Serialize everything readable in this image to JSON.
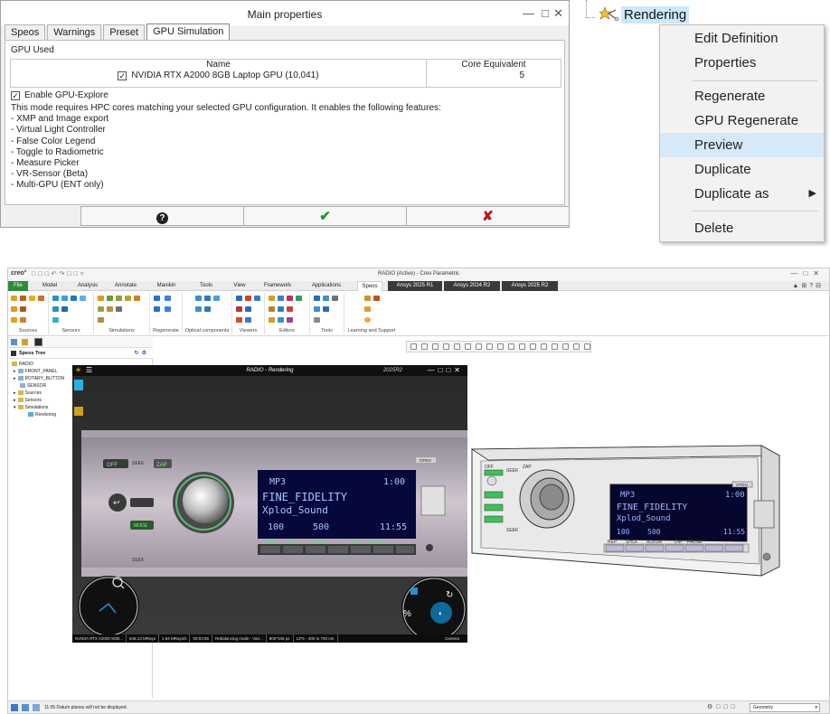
{
  "dialog": {
    "title": "Main properties",
    "tabs": [
      "Speos",
      "Warnings",
      "Preset",
      "GPU Simulation"
    ],
    "active_tab": "GPU Simulation",
    "gpu_used_label": "GPU Used",
    "table": {
      "col_name": "Name",
      "col_core": "Core Equivalent",
      "row_name": "NVIDIA RTX A2000 8GB Laptop GPU (10,041)",
      "row_core": "5",
      "row_checked": true
    },
    "enable_label": "Enable GPU-Explore",
    "enable_checked": true,
    "description": "This mode requires HPC cores matching your selected GPU configuration. It enables the following features:",
    "features": [
      "- XMP and Image export",
      "- Virtual Light Controller",
      "- False Color Legend",
      "- Toggle to Radiometric",
      "- Measure Picker",
      "- VR-Sensor (Beta)",
      "- Multi-GPU (ENT only)"
    ]
  },
  "context": {
    "node_label": "Rendering",
    "menu": {
      "edit_definition": "Edit Definition",
      "properties": "Properties",
      "regenerate": "Regenerate",
      "gpu_regenerate": "GPU Regenerate",
      "preview": "Preview",
      "duplicate": "Duplicate",
      "duplicate_as": "Duplicate as",
      "delete": "Delete"
    },
    "highlight_color": "#d6e9f8"
  },
  "creo": {
    "logo": "creo°",
    "window_title": "RADIO (Active) - Creo Parametric",
    "tabs": {
      "file": "File",
      "model": "Model",
      "analysis": "Analysis",
      "annotate": "Annotate",
      "manikin": "Manikin",
      "tools": "Tools",
      "view": "View",
      "framework": "Framework",
      "applications": "Applications",
      "speos": "Speos",
      "ansys_r1": "Ansys 2025 R1",
      "ansys_2024": "Ansys 2024 R2",
      "ansys_r2": "Ansys 2025 R2"
    },
    "groups": {
      "sources": "Sources",
      "sensors": "Sensors",
      "simulations": "Simulations",
      "regenerate": "Regenerate",
      "optical": "Optical components",
      "viewers": "Viewers",
      "editors": "Editors",
      "tools": "Tools",
      "learning": "Learning and Support"
    },
    "tree_header": "Speos Tree",
    "tree": {
      "root": "RADIO",
      "front_panel": "FRONT_PANEL",
      "rotary_button": "ROTARY_BUTTON",
      "sensor": "SENSOR",
      "sources": "Sources",
      "sensors": "Sensors",
      "simulations": "Simulations",
      "rendering": "Rendering"
    },
    "status_message": "11:05 Datum planes will not be displayed.",
    "filter_value": "Geometry",
    "file_tab_color": "#2e8b3b"
  },
  "gpu_window": {
    "title": "RADIO - Rendering",
    "version": "2025R2",
    "status": {
      "gpu": "NVIDIA RTX A2000 8GB...",
      "rays": "646.13 MRays",
      "rate": "1.94 MRays/s",
      "time": "00:03:55",
      "mode": "Rebalancing mode : Vari...",
      "res": "800*106 px",
      "spectral": "13*5 - 400 to 700 nm",
      "camera": "Camera"
    }
  },
  "radio": {
    "lcd_line1_tag": "MP3",
    "lcd_line1_right": "1:00",
    "lcd_line2": "FINE_FIDELITY",
    "lcd_line3": "Xplod_Sound",
    "lcd_track": "100",
    "lcd_count": "500",
    "lcd_clock": "11:55",
    "open_label": "OPEN",
    "off_label": "OFF",
    "seek_label": "SEEK",
    "zap_label": "ZAP",
    "mode_label": "MODE",
    "button_labels": [
      "REP",
      "SHUF",
      "ALBUM",
      "DM",
      "PAUSE"
    ]
  }
}
